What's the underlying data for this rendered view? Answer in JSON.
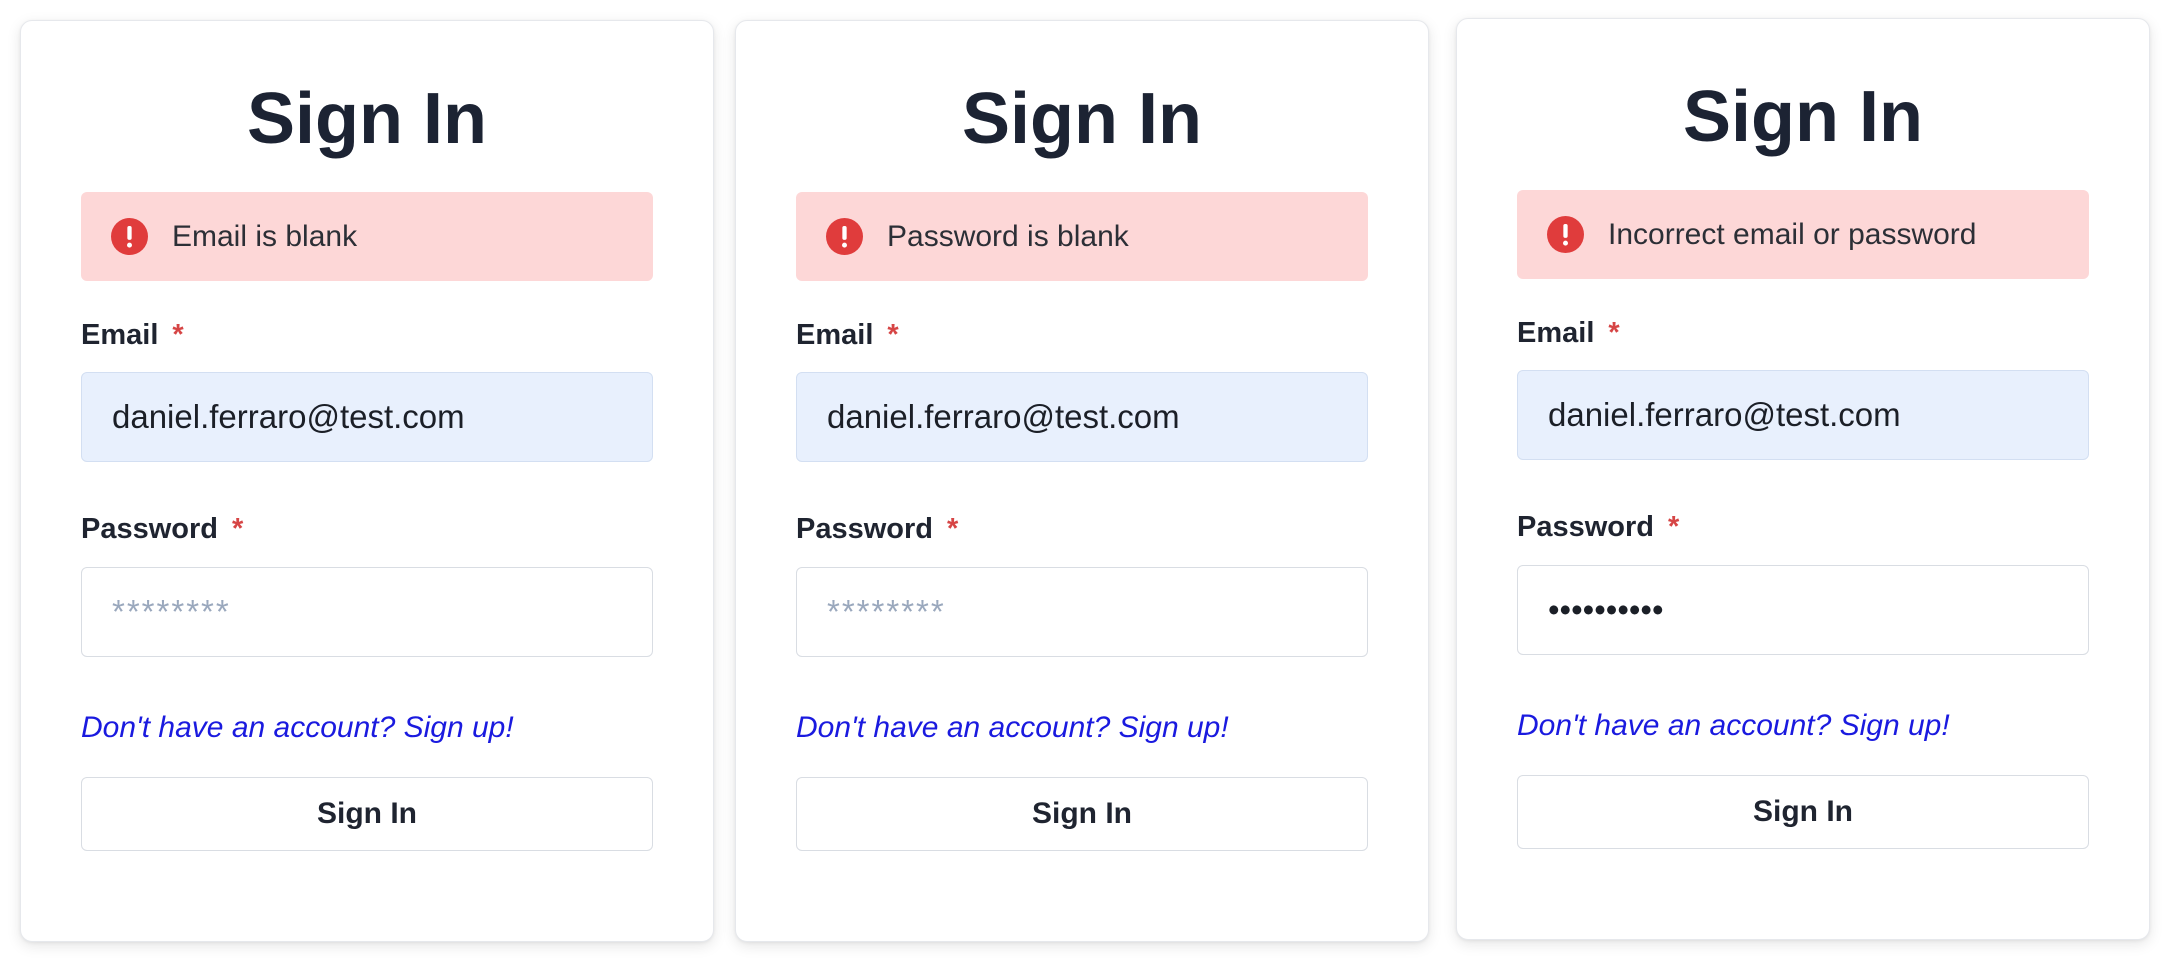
{
  "colors": {
    "alert_bg": "#fdd7d7",
    "alert_icon": "#e03c3c",
    "required_mark": "#d64545",
    "link": "#1a1adf",
    "email_field_bg": "#e8f0fd",
    "password_placeholder": "#9aa8bd"
  },
  "cards": [
    {
      "title": "Sign In",
      "alert": {
        "icon": "exclamation-circle-icon",
        "text": "Email is blank"
      },
      "email": {
        "label": "Email",
        "required_mark": "*",
        "value": "daniel.ferraro@test.com"
      },
      "password": {
        "label": "Password",
        "required_mark": "*",
        "value": "",
        "placeholder": "********"
      },
      "signup_link": "Don't have an account? Sign up!",
      "submit_label": "Sign In"
    },
    {
      "title": "Sign In",
      "alert": {
        "icon": "exclamation-circle-icon",
        "text": "Password is blank"
      },
      "email": {
        "label": "Email",
        "required_mark": "*",
        "value": "daniel.ferraro@test.com"
      },
      "password": {
        "label": "Password",
        "required_mark": "*",
        "value": "",
        "placeholder": "********"
      },
      "signup_link": "Don't have an account? Sign up!",
      "submit_label": "Sign In"
    },
    {
      "title": "Sign In",
      "alert": {
        "icon": "exclamation-circle-icon",
        "text": "Incorrect email or password"
      },
      "email": {
        "label": "Email",
        "required_mark": "*",
        "value": "daniel.ferraro@test.com"
      },
      "password": {
        "label": "Password",
        "required_mark": "*",
        "value": "••••••••••",
        "placeholder": "********"
      },
      "signup_link": "Don't have an account? Sign up!",
      "submit_label": "Sign In"
    }
  ]
}
